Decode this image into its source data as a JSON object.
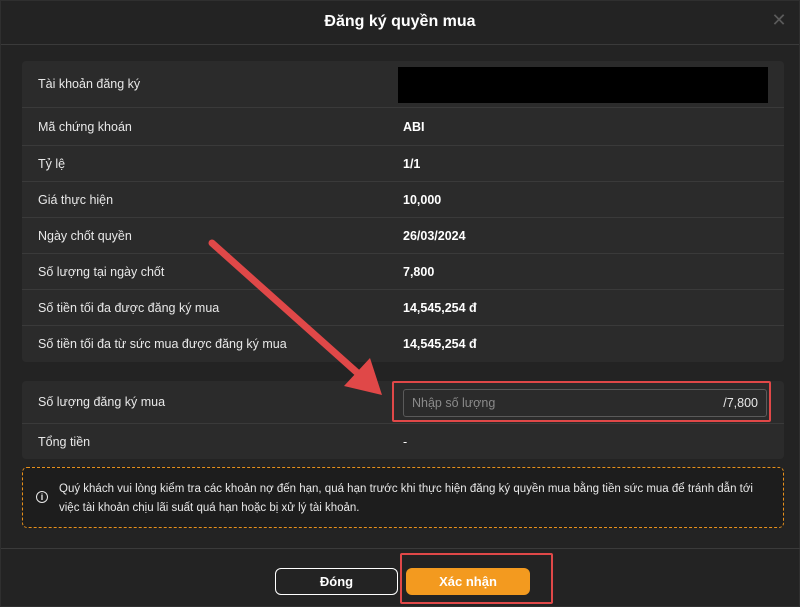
{
  "dialog": {
    "title": "Đăng ký quyền mua",
    "close_symbol": "✕"
  },
  "info": {
    "rows": [
      {
        "label": "Tài khoản đăng ký",
        "value": ""
      },
      {
        "label": "Mã chứng khoán",
        "value": "ABI"
      },
      {
        "label": "Tỷ lệ",
        "value": "1/1"
      },
      {
        "label": "Giá thực hiện",
        "value": "10,000"
      },
      {
        "label": "Ngày chốt quyền",
        "value": "26/03/2024"
      },
      {
        "label": "Số lượng tại ngày chốt",
        "value": "7,800"
      },
      {
        "label": "Số tiền tối đa được đăng ký mua",
        "value": "14,545,254 đ"
      },
      {
        "label": "Số tiền tối đa từ sức mua được đăng ký mua",
        "value": "14,545,254 đ"
      }
    ]
  },
  "registration": {
    "quantity_label": "Số lượng đăng ký mua",
    "quantity_placeholder": "Nhập số lượng",
    "quantity_value": "",
    "quantity_max": "/7,800",
    "total_label": "Tổng tiền",
    "total_value": "-"
  },
  "notice": {
    "icon": "info-icon",
    "text": "Quý khách vui lòng kiểm tra các khoản nợ đến hạn, quá hạn trước khi thực hiện đăng ký quyền mua bằng tiền sức mua để tránh dẫn tới việc tài khoản chịu lãi suất quá hạn hoặc bị xử lý tài khoản."
  },
  "footer": {
    "close_label": "Đóng",
    "confirm_label": "Xác nhận"
  },
  "colors": {
    "background": "#232323",
    "panel": "#2b2b2b",
    "accent": "#f39a1f",
    "annotation": "#e04848"
  }
}
